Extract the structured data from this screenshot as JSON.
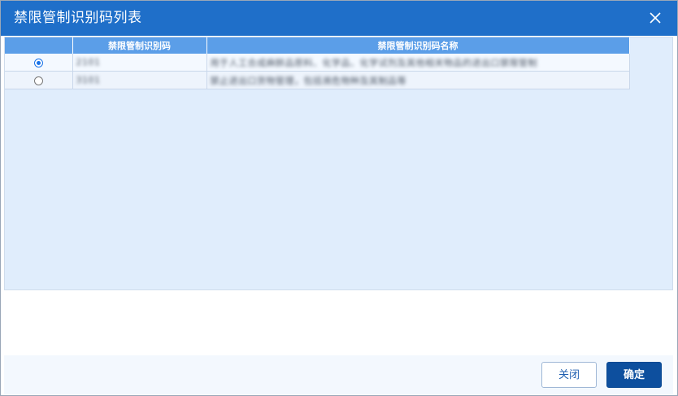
{
  "dialog": {
    "title": "禁限管制识别码列表"
  },
  "grid": {
    "columns": [
      "",
      "禁限管制识别码",
      "禁限管制识别码名称"
    ],
    "rows": [
      {
        "selected": true,
        "code": "2101",
        "name": "用于人工合成麻醉品原料、化学品、化学试剂及其他相关物品的进出口禁限管制"
      },
      {
        "selected": false,
        "code": "3101",
        "name": "禁止进出口货物管理，包括濒危物种及其制品等"
      }
    ]
  },
  "footer": {
    "close_label": "关闭",
    "ok_label": "确定"
  },
  "icons": {
    "close": "close-icon"
  },
  "colors": {
    "titlebar": "#1f6fc9",
    "header": "#5b9ee8",
    "ok_button": "#0d4f9e"
  }
}
